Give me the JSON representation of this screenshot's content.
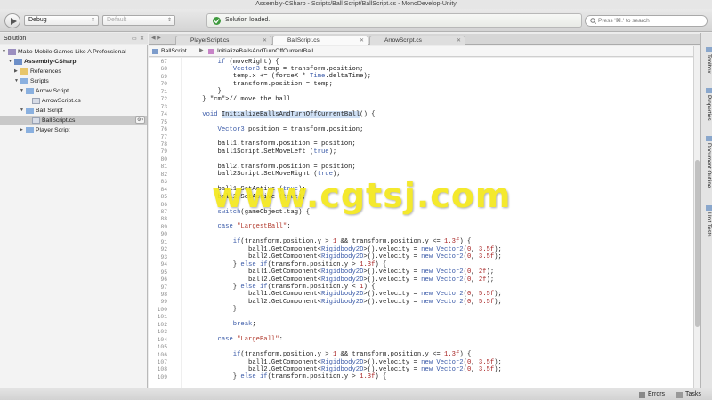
{
  "window": {
    "title": "Assembly-CSharp - Scripts/Ball Script/BallScript.cs - MonoDevelop-Unity"
  },
  "toolbar": {
    "config": "Debug",
    "target": "Default",
    "status": "Solution loaded.",
    "search_placeholder": "Press '⌘.' to search"
  },
  "solution": {
    "title": "Solution",
    "tree": [
      {
        "label": "Make Mobile Games Like A Professional",
        "icon": "solution-icon",
        "bold": false
      },
      {
        "label": "Assembly-CSharp",
        "icon": "project-icon",
        "bold": true
      },
      {
        "label": "References",
        "icon": "folder-icon",
        "bold": false
      },
      {
        "label": "Scripts",
        "icon": "folder-icon",
        "bold": false
      },
      {
        "label": "Arrow Script",
        "icon": "folder-icon",
        "bold": false
      },
      {
        "label": "ArrowScript.cs",
        "icon": "file-icon",
        "bold": false
      },
      {
        "label": "Ball Script",
        "icon": "folder-icon",
        "bold": false
      },
      {
        "label": "BallScript.cs",
        "icon": "file-icon",
        "bold": false,
        "selected": true
      },
      {
        "label": "Player Script",
        "icon": "folder-icon",
        "bold": false
      }
    ]
  },
  "tabs": [
    {
      "label": "PlayerScript.cs",
      "active": false
    },
    {
      "label": "BallScript.cs",
      "active": true
    },
    {
      "label": "ArrowScript.cs",
      "active": false
    }
  ],
  "breadcrumb": {
    "class": "BallScript",
    "method": "InitializeBallsAndTurnOffCurrentBall"
  },
  "editor": {
    "lines": [
      {
        "n": "67",
        "c": "        if (moveRight) {"
      },
      {
        "n": "68",
        "c": "            Vector3 temp = transform.position;"
      },
      {
        "n": "69",
        "c": "            temp.x += (forceX * Time.deltaTime);"
      },
      {
        "n": "70",
        "c": "            transform.position = temp;"
      },
      {
        "n": "71",
        "c": "        }"
      },
      {
        "n": "72",
        "c": "    } // move the ball"
      },
      {
        "n": "73",
        "c": ""
      },
      {
        "n": "74",
        "c": "    void InitializeBallsAndTurnOffCurrentBall() {"
      },
      {
        "n": "75",
        "c": ""
      },
      {
        "n": "76",
        "c": "        Vector3 position = transform.position;"
      },
      {
        "n": "77",
        "c": ""
      },
      {
        "n": "78",
        "c": "        ball1.transform.position = position;"
      },
      {
        "n": "79",
        "c": "        ball1Script.SetMoveLeft (true);"
      },
      {
        "n": "80",
        "c": ""
      },
      {
        "n": "81",
        "c": "        ball2.transform.position = position;"
      },
      {
        "n": "82",
        "c": "        ball2Script.SetMoveRight (true);"
      },
      {
        "n": "83",
        "c": ""
      },
      {
        "n": "84",
        "c": "        ball1.SetActive (true);"
      },
      {
        "n": "85",
        "c": "        ball2.SetActive (true);"
      },
      {
        "n": "86",
        "c": ""
      },
      {
        "n": "87",
        "c": "        switch(gameObject.tag) {"
      },
      {
        "n": "88",
        "c": ""
      },
      {
        "n": "89",
        "c": "        case \"LargestBall\":"
      },
      {
        "n": "90",
        "c": ""
      },
      {
        "n": "91",
        "c": "            if(transform.position.y > 1 && transform.position.y <= 1.3f) {"
      },
      {
        "n": "92",
        "c": "                ball1.GetComponent<Rigidbody2D>().velocity = new Vector2(0, 3.5f);"
      },
      {
        "n": "93",
        "c": "                ball2.GetComponent<Rigidbody2D>().velocity = new Vector2(0, 3.5f);"
      },
      {
        "n": "94",
        "c": "            } else if(transform.position.y > 1.3f) {"
      },
      {
        "n": "95",
        "c": "                ball1.GetComponent<Rigidbody2D>().velocity = new Vector2(0, 2f);"
      },
      {
        "n": "96",
        "c": "                ball2.GetComponent<Rigidbody2D>().velocity = new Vector2(0, 2f);"
      },
      {
        "n": "97",
        "c": "            } else if(transform.position.y < 1) {"
      },
      {
        "n": "98",
        "c": "                ball1.GetComponent<Rigidbody2D>().velocity = new Vector2(0, 5.5f);"
      },
      {
        "n": "99",
        "c": "                ball2.GetComponent<Rigidbody2D>().velocity = new Vector2(0, 5.5f);"
      },
      {
        "n": "100",
        "c": "            }"
      },
      {
        "n": "101",
        "c": ""
      },
      {
        "n": "102",
        "c": "            break;"
      },
      {
        "n": "103",
        "c": ""
      },
      {
        "n": "104",
        "c": "        case \"LargeBall\":"
      },
      {
        "n": "105",
        "c": ""
      },
      {
        "n": "106",
        "c": "            if(transform.position.y > 1 && transform.position.y <= 1.3f) {"
      },
      {
        "n": "107",
        "c": "                ball1.GetComponent<Rigidbody2D>().velocity = new Vector2(0, 3.5f);"
      },
      {
        "n": "108",
        "c": "                ball2.GetComponent<Rigidbody2D>().velocity = new Vector2(0, 3.5f);"
      },
      {
        "n": "109",
        "c": "            } else if(transform.position.y > 1.3f) {"
      }
    ]
  },
  "right_dock": [
    "Toolbox",
    "Properties",
    "Document Outline",
    "Unit Tests"
  ],
  "statusbar": {
    "errors": "Errors",
    "tasks": "Tasks"
  },
  "watermark": "www.cgtsj.com"
}
